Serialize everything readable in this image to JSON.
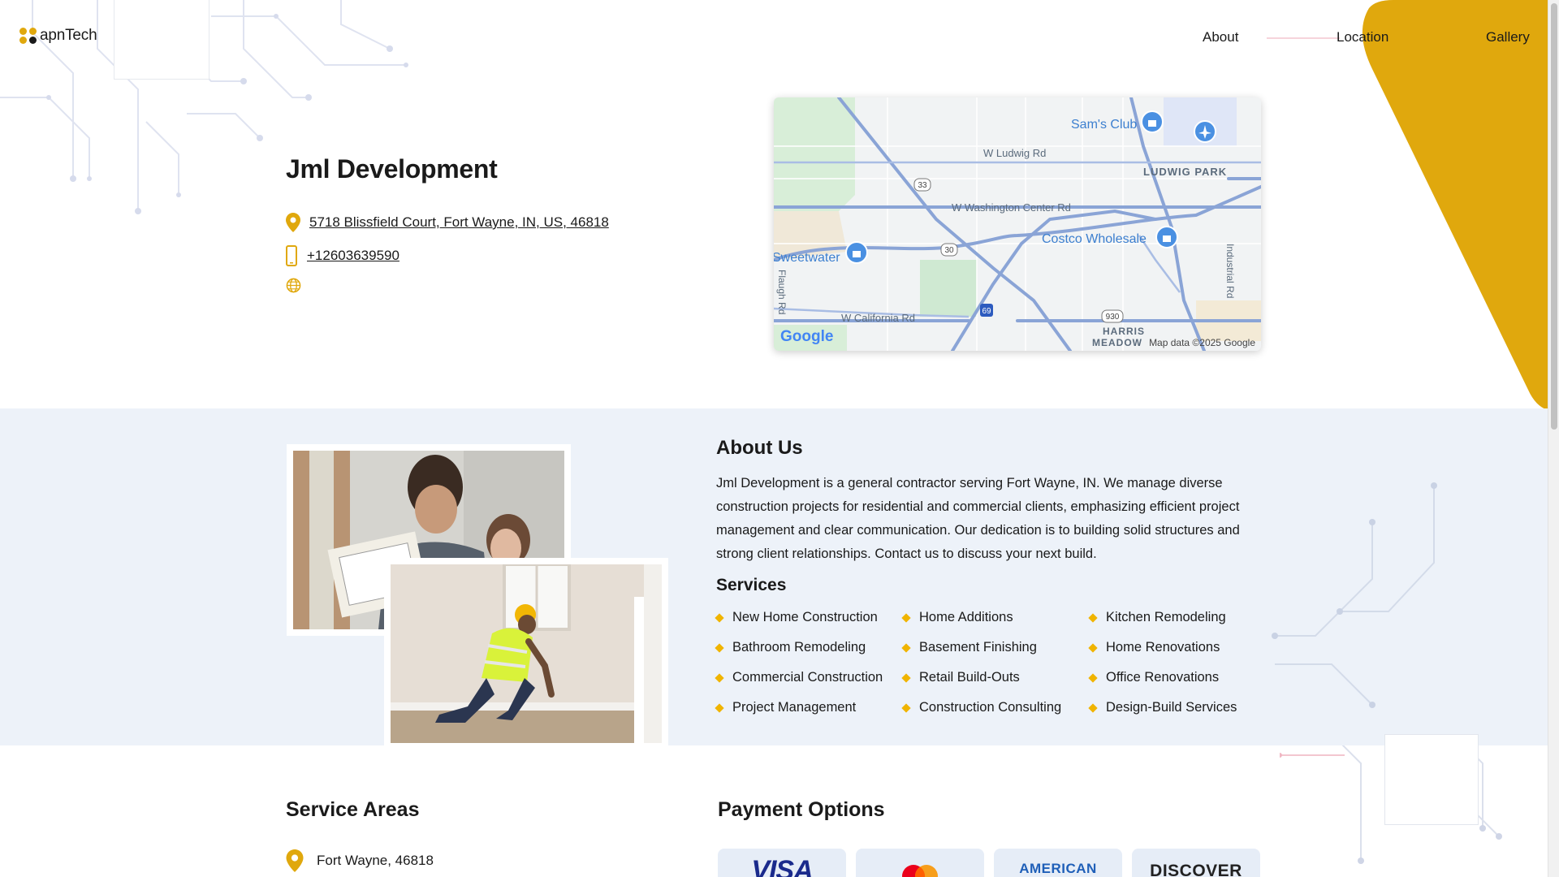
{
  "header": {
    "logo_text": "apnTech",
    "nav": [
      "About",
      "Location",
      "Gallery"
    ]
  },
  "business": {
    "name": "Jml Development",
    "address": "5718 Blissfield Court, Fort Wayne, IN, US, 46818",
    "phone": "+12603639590"
  },
  "map": {
    "labels": {
      "sams_club": "Sam's Club",
      "w_ludwig_rd": "W Ludwig Rd",
      "ludwig_park": "LUDWIG PARK",
      "w_washington_center_rd": "W Washington Center Rd",
      "costco": "Costco Wholesale",
      "sweetwater": "Sweetwater",
      "flaugh_rd": "Flaugh Rd",
      "industrial_rd": "Industrial Rd",
      "w_california_rd": "W California Rd",
      "harris": "HARRIS",
      "meadows": "MEADOW",
      "route_33": "33",
      "route_30": "30",
      "route_69": "69",
      "route_930": "930"
    },
    "attribution": "Map data ©2025 Google",
    "brand": "Google"
  },
  "about": {
    "title": "About Us",
    "text": "Jml Development is a general contractor serving Fort Wayne, IN. We manage diverse construction projects for residential and commercial clients, emphasizing efficient project management and clear communication. Our dedication is to building solid structures and strong client relationships. Contact us to discuss your next build.",
    "services_title": "Services",
    "services": [
      "New Home Construction",
      "Home Additions",
      "Kitchen Remodeling",
      "Bathroom Remodeling",
      "Basement Finishing",
      "Home Renovations",
      "Commercial Construction",
      "Retail Build-Outs",
      "Office Renovations",
      "Project Management",
      "Construction Consulting",
      "Design-Build Services"
    ]
  },
  "service_areas": {
    "title": "Service Areas",
    "items": [
      "Fort Wayne, 46818"
    ]
  },
  "payment": {
    "title": "Payment Options",
    "cards": [
      "VISA",
      "mastercard",
      "AMERICAN",
      "DISCOVER"
    ]
  },
  "colors": {
    "accent": "#e0a80d",
    "band": "#edf2f9",
    "text": "#1a1a1a"
  }
}
